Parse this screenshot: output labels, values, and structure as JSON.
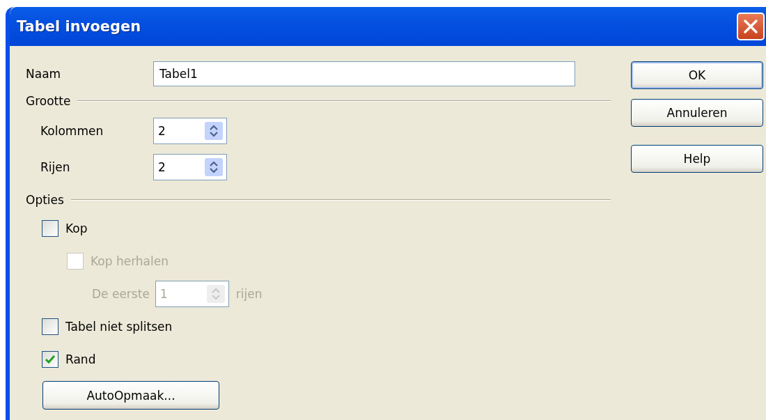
{
  "window": {
    "title": "Tabel invoegen"
  },
  "name": {
    "label": "Naam",
    "value": "Tabel1"
  },
  "size": {
    "heading": "Grootte",
    "fields": [
      {
        "label": "Kolommen",
        "value": "2"
      },
      {
        "label": "Rijen",
        "value": "2"
      }
    ]
  },
  "options": {
    "heading": "Opties",
    "items": [
      {
        "kind": "checkbox",
        "label": "Kop",
        "checked": false,
        "disabled": false,
        "children": [
          {
            "kind": "checkbox",
            "label": "Kop herhalen",
            "checked": false,
            "disabled": true,
            "children": [
              {
                "kind": "spin",
                "label": "De eerste",
                "value": "1",
                "suffix": "rijen",
                "disabled": true
              }
            ]
          }
        ]
      },
      {
        "kind": "checkbox",
        "label": "Tabel niet splitsen",
        "checked": false,
        "disabled": false
      },
      {
        "kind": "checkbox",
        "label": "Rand",
        "checked": true,
        "disabled": false
      }
    ]
  },
  "autoformat_button": "AutoOpmaak...",
  "buttons": [
    {
      "label": "OK",
      "default": true
    },
    {
      "label": "Annuleren",
      "default": false
    },
    {
      "label": "Help",
      "default": false
    }
  ]
}
